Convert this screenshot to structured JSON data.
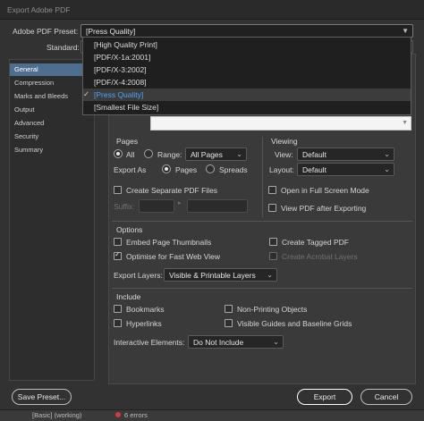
{
  "window": {
    "title": "Export Adobe PDF"
  },
  "preset": {
    "label": "Adobe PDF Preset:",
    "value": "[Press Quality]"
  },
  "standard": {
    "label": "Standard:"
  },
  "preset_options": [
    "[High Quality Print]",
    "[PDF/X-1a:2001]",
    "[PDF/X-3:2002]",
    "[PDF/X-4:2008]",
    "[Press Quality]",
    "[Smallest File Size]"
  ],
  "sidebar": {
    "items": [
      {
        "label": "General"
      },
      {
        "label": "Compression"
      },
      {
        "label": "Marks and Bleeds"
      },
      {
        "label": "Output"
      },
      {
        "label": "Advanced"
      },
      {
        "label": "Security"
      },
      {
        "label": "Summary"
      }
    ]
  },
  "pages": {
    "title": "Pages",
    "all_label": "All",
    "range_label": "Range:",
    "range_value": "All Pages",
    "export_as_label": "Export As",
    "pages_label": "Pages",
    "spreads_label": "Spreads",
    "separate_files_label": "Create Separate PDF Files",
    "suffix_label": "Suffix:"
  },
  "viewing": {
    "title": "Viewing",
    "view_label": "View:",
    "view_value": "Default",
    "layout_label": "Layout:",
    "layout_value": "Default",
    "fullscreen_label": "Open in Full Screen Mode",
    "view_after_label": "View PDF after Exporting"
  },
  "options": {
    "title": "Options",
    "embed_thumbs_label": "Embed Page Thumbnails",
    "tagged_pdf_label": "Create Tagged PDF",
    "fast_web_label": "Optimise for Fast Web View",
    "acrobat_layers_label": "Create Acrobat Layers",
    "export_layers_label": "Export Layers:",
    "export_layers_value": "Visible & Printable Layers"
  },
  "include": {
    "title": "Include",
    "bookmarks_label": "Bookmarks",
    "non_printing_label": "Non-Printing Objects",
    "hyperlinks_label": "Hyperlinks",
    "guides_label": "Visible Guides and Baseline Grids",
    "interactive_label": "Interactive Elements:",
    "interactive_value": "Do Not Include"
  },
  "footer": {
    "save_preset_label": "Save Preset...",
    "export_label": "Export",
    "cancel_label": "Cancel"
  },
  "statusbar": {
    "profile": "[Basic] (working)",
    "errors": "6 errors"
  }
}
